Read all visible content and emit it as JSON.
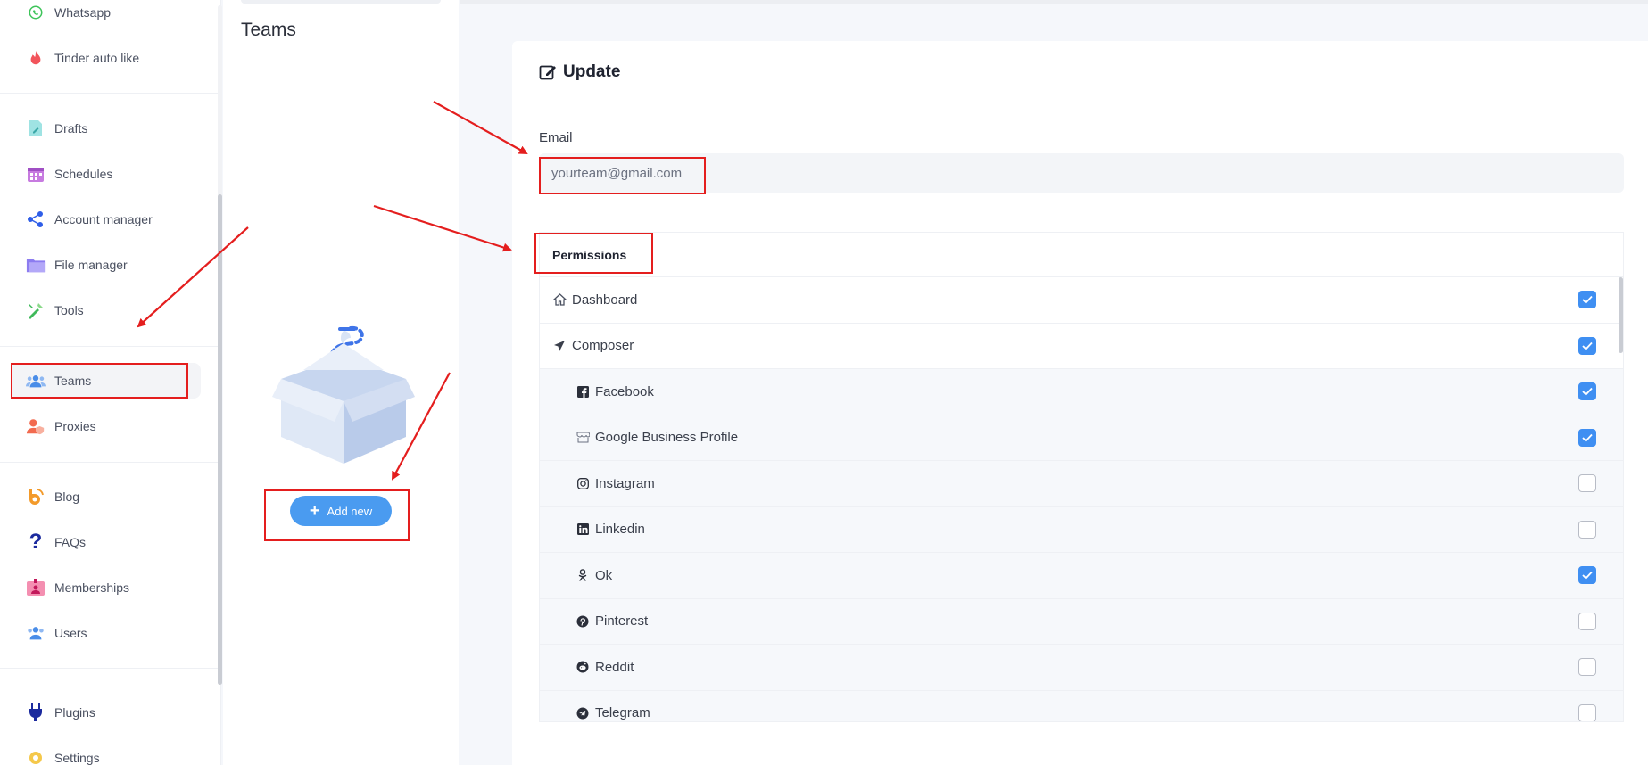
{
  "sidebar": {
    "items": [
      {
        "label": "Whatsapp",
        "icon": "whatsapp-icon"
      },
      {
        "label": "Tinder auto like",
        "icon": "tinder-icon"
      },
      {
        "label": "Drafts",
        "icon": "drafts-icon"
      },
      {
        "label": "Schedules",
        "icon": "calendar-icon"
      },
      {
        "label": "Account manager",
        "icon": "share-nodes-icon"
      },
      {
        "label": "File manager",
        "icon": "folder-icon"
      },
      {
        "label": "Tools",
        "icon": "tools-icon"
      },
      {
        "label": "Teams",
        "icon": "team-icon"
      },
      {
        "label": "Proxies",
        "icon": "proxy-user-icon"
      },
      {
        "label": "Blog",
        "icon": "blog-icon"
      },
      {
        "label": "FAQs",
        "icon": "question-icon"
      },
      {
        "label": "Memberships",
        "icon": "membership-badge-icon"
      },
      {
        "label": "Users",
        "icon": "users-icon"
      },
      {
        "label": "Plugins",
        "icon": "plug-icon"
      },
      {
        "label": "Settings",
        "icon": "settings-gear-icon"
      }
    ],
    "active": "Teams"
  },
  "teams": {
    "title": "Teams",
    "add_button": "Add new"
  },
  "update": {
    "title": "Update",
    "email_label": "Email",
    "email_value": "yourteam@gmail.com",
    "permissions_title": "Permissions",
    "permissions": [
      {
        "label": "Dashboard",
        "icon": "home-icon",
        "checked": true,
        "sub": false
      },
      {
        "label": "Composer",
        "icon": "paper-plane-icon",
        "checked": true,
        "sub": false
      },
      {
        "label": "Facebook",
        "icon": "facebook-icon",
        "checked": true,
        "sub": true
      },
      {
        "label": "Google Business Profile",
        "icon": "store-icon",
        "checked": true,
        "sub": true
      },
      {
        "label": "Instagram",
        "icon": "instagram-icon",
        "checked": false,
        "sub": true
      },
      {
        "label": "Linkedin",
        "icon": "linkedin-icon",
        "checked": false,
        "sub": true
      },
      {
        "label": "Ok",
        "icon": "odnoklassniki-icon",
        "checked": true,
        "sub": true
      },
      {
        "label": "Pinterest",
        "icon": "pinterest-icon",
        "checked": false,
        "sub": true
      },
      {
        "label": "Reddit",
        "icon": "reddit-icon",
        "checked": false,
        "sub": true
      },
      {
        "label": "Telegram",
        "icon": "telegram-icon",
        "checked": false,
        "sub": true
      }
    ]
  },
  "colors": {
    "accent": "#3f8ff2",
    "button": "#4a9bf0",
    "annotation": "#e41e1e"
  }
}
